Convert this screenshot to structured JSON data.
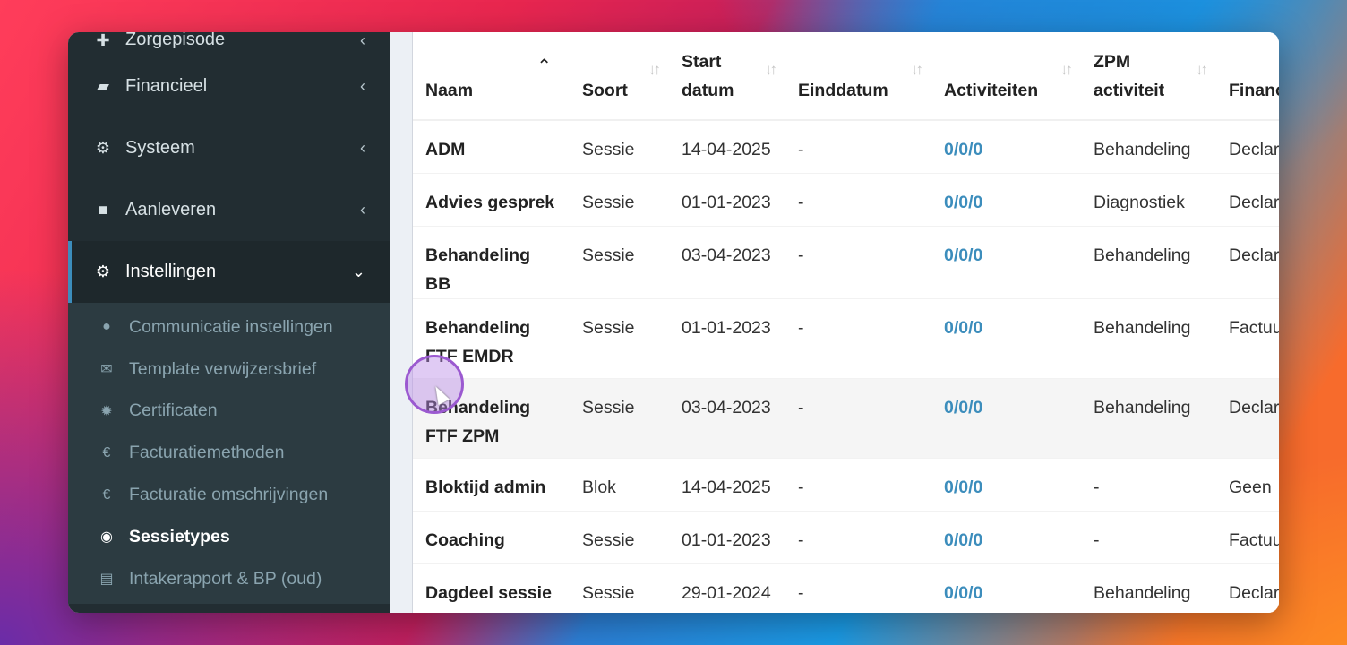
{
  "sidebar": {
    "items": [
      {
        "label": "Zorgepisode",
        "icon": "medkit-icon"
      },
      {
        "label": "Financieel",
        "icon": "book-icon"
      },
      {
        "label": "Systeem",
        "icon": "cogs-icon"
      },
      {
        "label": "Aanleveren",
        "icon": "truck-icon"
      },
      {
        "label": "Instellingen",
        "icon": "gear-icon"
      }
    ],
    "submenu": [
      {
        "label": "Communicatie instellingen",
        "icon": "comments-icon"
      },
      {
        "label": "Template verwijzersbrief",
        "icon": "envelope-icon"
      },
      {
        "label": "Certificaten",
        "icon": "certificate-icon"
      },
      {
        "label": "Facturatiemethoden",
        "icon": "euro-icon"
      },
      {
        "label": "Facturatie omschrijvingen",
        "icon": "euro-icon"
      },
      {
        "label": "Sessietypes",
        "icon": "globe-icon"
      },
      {
        "label": "Intakerapport & BP (oud)",
        "icon": "file-icon"
      }
    ]
  },
  "table": {
    "headers": {
      "naam": "Naam",
      "soort": "Soort",
      "start_1": "Start",
      "start_2": "datum",
      "eind": "Einddatum",
      "act": "Activiteiten",
      "zpm_1": "ZPM",
      "zpm_2": "activiteit",
      "fin": "Financiering"
    },
    "rows": [
      {
        "naam": "ADM",
        "soort": "Sessie",
        "start": "14-04-2025",
        "eind": "-",
        "act": "0/0/0",
        "zpm": "Behandeling",
        "fin": "Declaratie"
      },
      {
        "naam": "Advies gesprek",
        "soort": "Sessie",
        "start": "01-01-2023",
        "eind": "-",
        "act": "0/0/0",
        "zpm": "Diagnostiek",
        "fin": "Declaratie"
      },
      {
        "naam": "Behandeling BB",
        "soort": "Sessie",
        "start": "03-04-2023",
        "eind": "-",
        "act": "0/0/0",
        "zpm": "Behandeling",
        "fin": "Declaratie"
      },
      {
        "naam": "Behandeling FTF EMDR",
        "soort": "Sessie",
        "start": "01-01-2023",
        "eind": "-",
        "act": "0/0/0",
        "zpm": "Behandeling",
        "fin": "Factuur"
      },
      {
        "naam": "Behandeling FTF ZPM",
        "soort": "Sessie",
        "start": "03-04-2023",
        "eind": "-",
        "act": "0/0/0",
        "zpm": "Behandeling",
        "fin": "Declaratie"
      },
      {
        "naam": "Bloktijd admin",
        "soort": "Blok",
        "start": "14-04-2025",
        "eind": "-",
        "act": "0/0/0",
        "zpm": "-",
        "fin": "Geen"
      },
      {
        "naam": "Coaching",
        "soort": "Sessie",
        "start": "01-01-2023",
        "eind": "-",
        "act": "0/0/0",
        "zpm": "-",
        "fin": "Factuur"
      },
      {
        "naam": "Dagdeel sessie met",
        "soort": "Sessie",
        "start": "29-01-2024",
        "eind": "-",
        "act": "0/0/0",
        "zpm": "Behandeling",
        "fin": "Declaratie"
      }
    ]
  }
}
